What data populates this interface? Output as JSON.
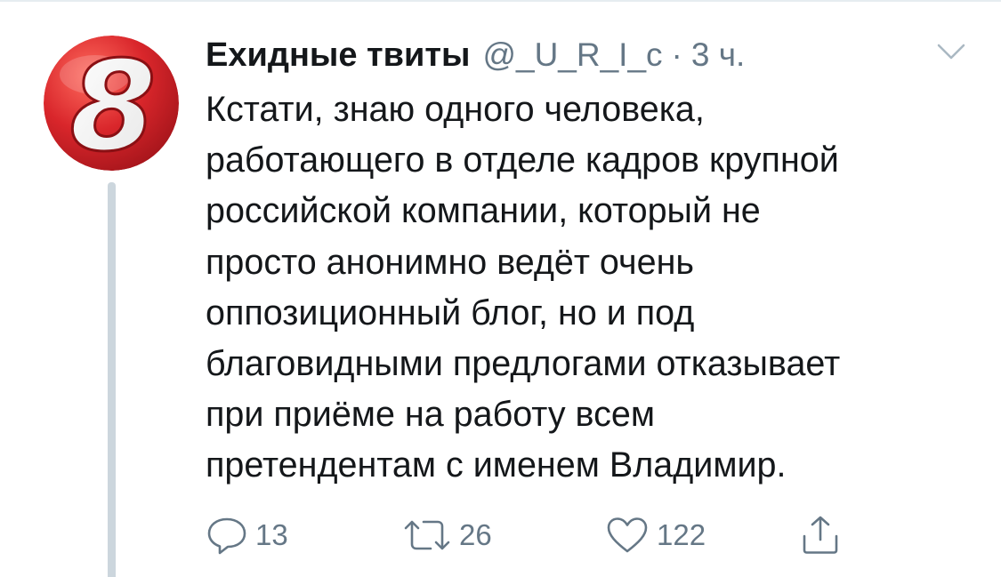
{
  "tweet": {
    "avatar_icon": "number-8-logo-icon",
    "avatar_glyph": "8",
    "author": {
      "display_name": "Ехидные твиты",
      "handle": "@_U_R_I_c",
      "separator": "·",
      "time": "3 ч."
    },
    "text_lines": [
      "Кстати, знаю одного человека,",
      "работающего в отделе кадров крупной",
      "российской компании, который не",
      "просто анонимно ведёт очень",
      "оппозиционный блог, но и под",
      "благовидными предлогами отказывает",
      "при приёме на работу всем",
      "претендентам с именем Владимир."
    ],
    "actions": {
      "reply": {
        "icon": "reply-icon",
        "count": "13"
      },
      "retweet": {
        "icon": "retweet-icon",
        "count": "26"
      },
      "like": {
        "icon": "heart-icon",
        "count": "122"
      },
      "share": {
        "icon": "share-icon"
      }
    },
    "menu_icon": "chevron-down-icon"
  },
  "colors": {
    "text": "#14171a",
    "secondary": "#657786",
    "thread_line": "#ccd6dd",
    "avatar_red": "#d7272a"
  }
}
